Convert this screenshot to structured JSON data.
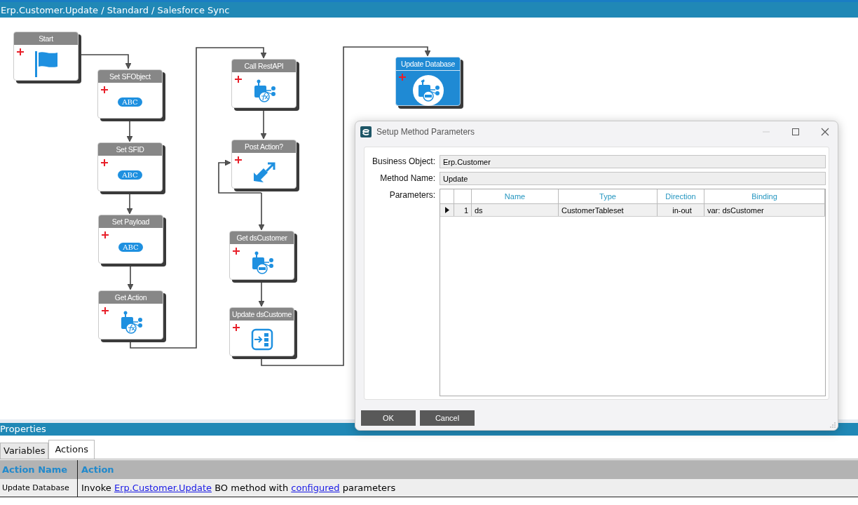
{
  "window": {
    "title": "Erp.Customer.Update / Standard / Salesforce Sync"
  },
  "nodes": [
    {
      "title": "Start",
      "kind": "flag",
      "selected": false
    },
    {
      "title": "Set SFObject",
      "kind": "abc",
      "badge": "ABC",
      "selected": false
    },
    {
      "title": "Set SFID",
      "kind": "abc",
      "badge": "ABC",
      "selected": false
    },
    {
      "title": "Set Payload",
      "kind": "abc",
      "badge": "ABC",
      "selected": false
    },
    {
      "title": "Get Action",
      "kind": "function",
      "selected": false
    },
    {
      "title": "Call RestAPI",
      "kind": "function",
      "selected": false
    },
    {
      "title": "Post Action?",
      "kind": "decision",
      "selected": false
    },
    {
      "title": "Get dsCustomer",
      "kind": "method",
      "selected": false
    },
    {
      "title": "Update dsCustome",
      "kind": "update",
      "selected": false
    },
    {
      "title": "Update Database",
      "kind": "method",
      "selected": true
    }
  ],
  "dialog": {
    "title": "Setup Method Parameters",
    "fields": [
      {
        "label": "Business Object:",
        "value": "Erp.Customer"
      },
      {
        "label": "Method Name:",
        "value": "Update"
      }
    ],
    "parameters_label": "Parameters:",
    "columns": [
      "Name",
      "Type",
      "Direction",
      "Binding"
    ],
    "rows": [
      {
        "number": "1",
        "selected": true,
        "cells": [
          "ds",
          "CustomerTableset",
          "in-out",
          "var: dsCustomer"
        ]
      }
    ],
    "buttons": [
      "OK",
      "Cancel"
    ]
  },
  "properties": {
    "title": "Properties",
    "tabs": [
      {
        "label": "Variables",
        "selected": false
      },
      {
        "label": "Actions",
        "selected": true
      }
    ],
    "columns": [
      "Action Name",
      "Action"
    ],
    "rows": [
      {
        "name": "Update Database",
        "action": [
          {
            "kind": "text",
            "text": "Invoke "
          },
          {
            "kind": "link",
            "text": "Erp.Customer.Update"
          },
          {
            "kind": "text",
            "text": " BO method with "
          },
          {
            "kind": "link",
            "text": "configured"
          },
          {
            "kind": "text",
            "text": " parameters"
          }
        ]
      }
    ]
  }
}
